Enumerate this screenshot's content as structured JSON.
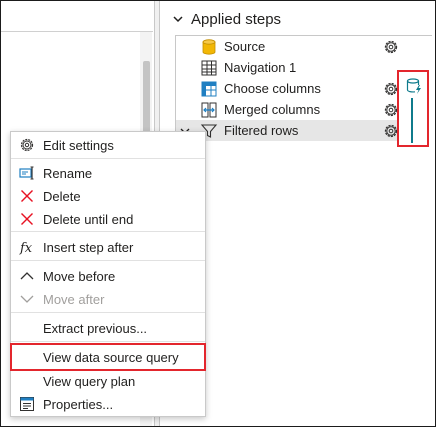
{
  "applied_steps": {
    "title": "Applied steps",
    "steps": [
      {
        "label": "Source",
        "icon": "database-icon",
        "has_gear": true
      },
      {
        "label": "Navigation 1",
        "icon": "table-grid-icon",
        "has_gear": false
      },
      {
        "label": "Choose columns",
        "icon": "table-columns-icon",
        "has_gear": true
      },
      {
        "label": "Merged columns",
        "icon": "merge-columns-icon",
        "has_gear": true
      },
      {
        "label": "Filtered rows",
        "icon": "filter-icon",
        "has_gear": true,
        "selected": true
      }
    ]
  },
  "context_menu": {
    "items": [
      {
        "label": "Edit settings",
        "icon": "gear-icon"
      },
      {
        "label": "Rename",
        "icon": "rename-icon"
      },
      {
        "label": "Delete",
        "icon": "close-x-icon"
      },
      {
        "label": "Delete until end",
        "icon": "close-x-icon"
      },
      {
        "label": "Insert step after",
        "icon": "fx-icon"
      },
      {
        "label": "Move before",
        "icon": "chevron-up-icon"
      },
      {
        "label": "Move after",
        "icon": "chevron-down-icon",
        "disabled": true
      },
      {
        "label": "Extract previous...",
        "icon": ""
      },
      {
        "label": "View data source query",
        "icon": "",
        "highlighted": true
      },
      {
        "label": "View query plan",
        "icon": ""
      },
      {
        "label": "Properties...",
        "icon": "properties-icon"
      }
    ]
  },
  "colors": {
    "highlight_red": "#e3262d",
    "teal_accent": "#0f7b8c",
    "source_db_yellow": "#f2b705",
    "table_blue": "#1f7fc2",
    "delete_red": "#e81123"
  }
}
